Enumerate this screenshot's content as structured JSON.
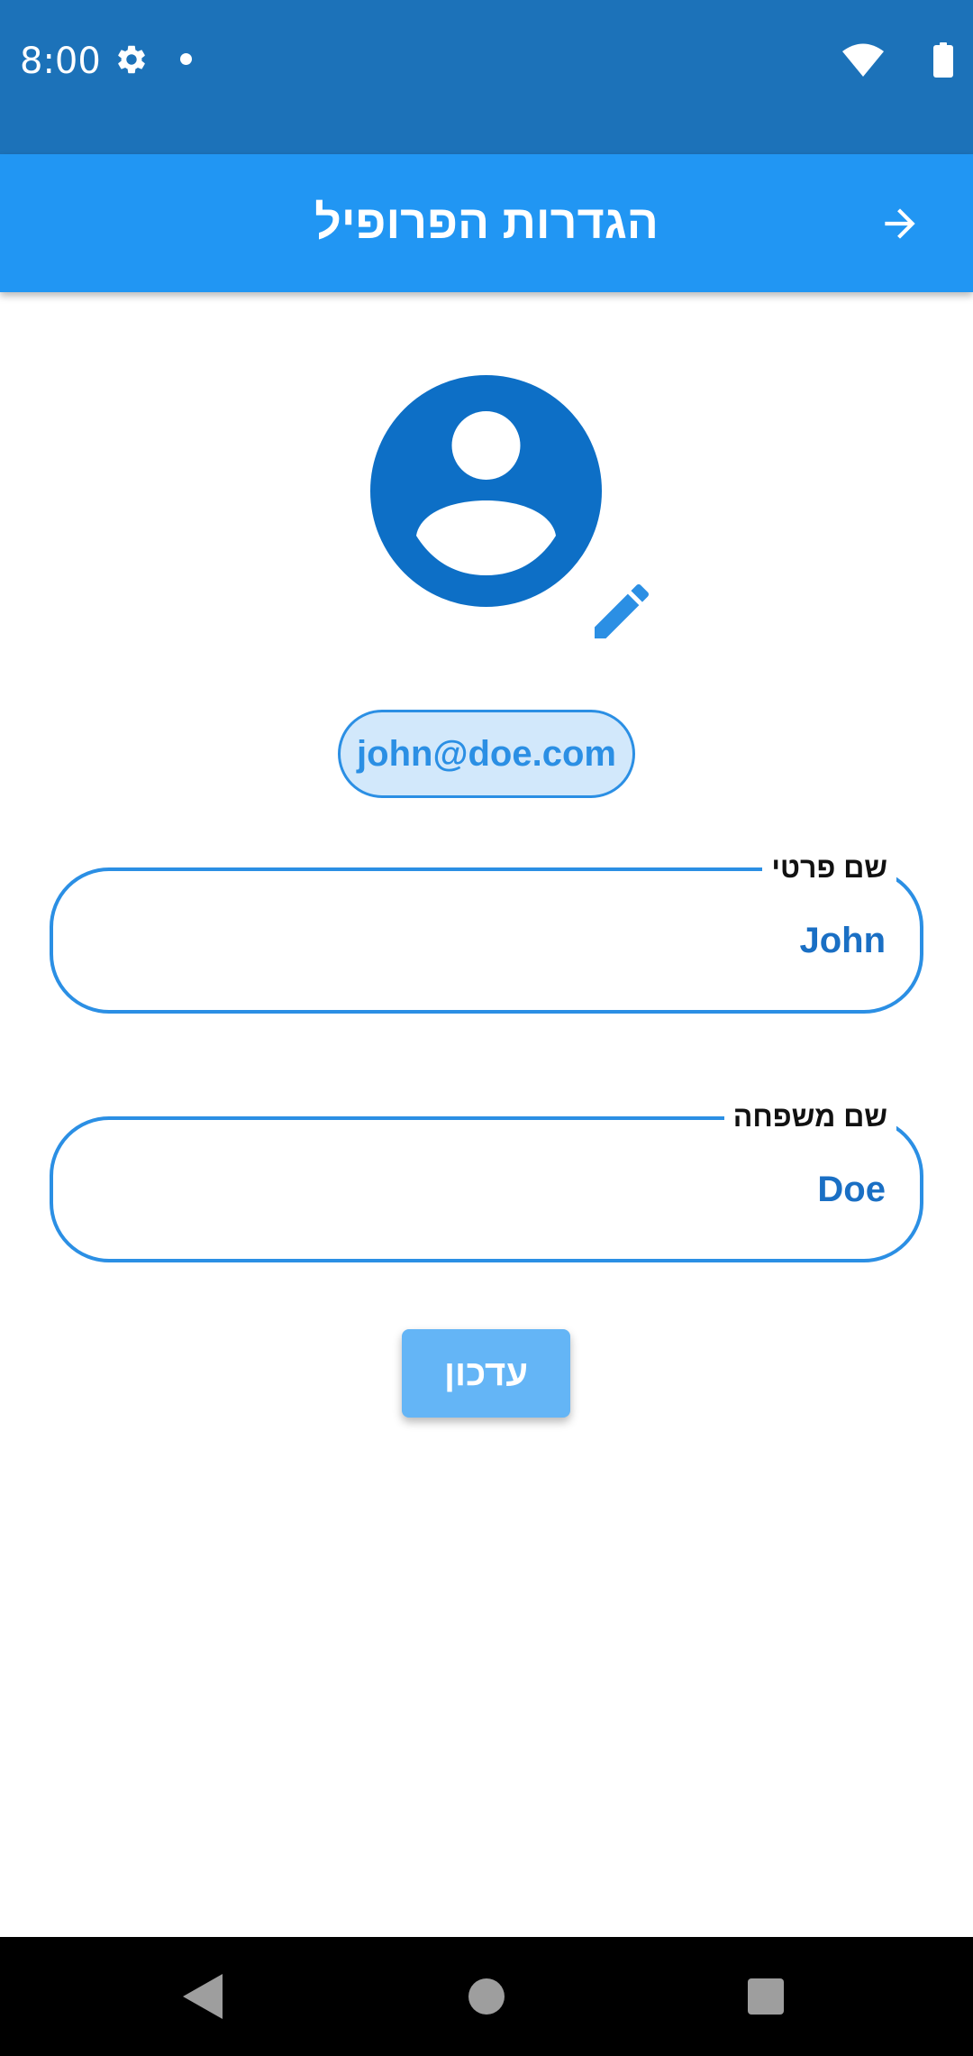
{
  "status_bar": {
    "time": "8:00",
    "icons": [
      "gear-icon",
      "notification-dot-icon",
      "wifi-icon",
      "battery-icon"
    ]
  },
  "app_bar": {
    "title": "הגדרות הפרופיל",
    "back_icon": "arrow-right-icon"
  },
  "profile": {
    "avatar_icon": "account-circle-icon",
    "edit_icon": "pencil-icon",
    "email": "john@doe.com"
  },
  "form": {
    "first_name": {
      "label": "שם פרטי",
      "value": "John"
    },
    "last_name": {
      "label": "שם משפחה",
      "value": "Doe"
    },
    "update_label": "עדכון"
  },
  "nav_bar": {
    "icons": [
      "back-triangle-icon",
      "home-circle-icon",
      "recents-square-icon"
    ]
  },
  "colors": {
    "status_bar": "#1c72b9",
    "app_bar": "#2196f3",
    "accent": "#2b8fe4",
    "avatar": "#0d6fc6",
    "field_text": "#1a6fc4",
    "button": "#64b5f6"
  }
}
